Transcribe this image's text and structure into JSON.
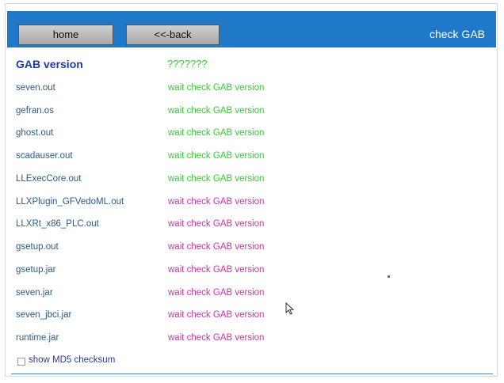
{
  "toolbar": {
    "home_label": "home",
    "back_label": "<<-back",
    "title": "check GAB",
    "accent_color": "#1f78c8"
  },
  "header": {
    "label": "GAB version",
    "value": "???????"
  },
  "files": [
    {
      "name": "seven.out",
      "status": "wait check GAB version",
      "color": "green"
    },
    {
      "name": "gefran.os",
      "status": "wait check GAB version",
      "color": "green"
    },
    {
      "name": "ghost.out",
      "status": "wait check GAB version",
      "color": "green"
    },
    {
      "name": "scadauser.out",
      "status": "wait check GAB version",
      "color": "green"
    },
    {
      "name": "LLExecCore.out",
      "status": "wait check GAB version",
      "color": "green"
    },
    {
      "name": "LLXPlugin_GFVedoML.out",
      "status": "wait check GAB version",
      "color": "magenta"
    },
    {
      "name": "LLXRt_x86_PLC.out",
      "status": "wait check GAB version",
      "color": "magenta"
    },
    {
      "name": "gsetup.out",
      "status": "wait check GAB version",
      "color": "magenta"
    },
    {
      "name": "gsetup.jar",
      "status": "wait check GAB version",
      "color": "magenta"
    },
    {
      "name": "seven.jar",
      "status": "wait check GAB version",
      "color": "magenta"
    },
    {
      "name": "seven_jbci.jar",
      "status": "wait check GAB version",
      "color": "magenta"
    },
    {
      "name": "runtime.jar",
      "status": "wait check GAB version",
      "color": "magenta"
    }
  ],
  "checkbox": {
    "label": "show MD5 checksum",
    "checked": false
  },
  "icons": {
    "cursor": "mouse-pointer-icon"
  }
}
